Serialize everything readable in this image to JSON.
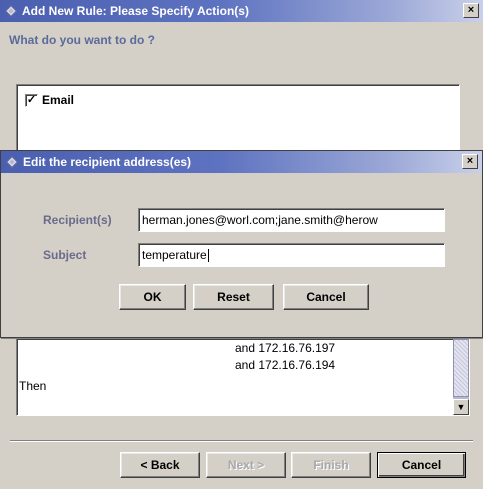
{
  "back_window": {
    "title": "Add New Rule: Please Specify Action(s)",
    "close": "×",
    "question": "What do you want to do ?",
    "actions": [
      {
        "label": "Email",
        "checked": true,
        "mark": "✓"
      }
    ],
    "rule_text": {
      "line1": "and 172.16.76.197",
      "line2": "and 172.16.76.194",
      "line3": "Then"
    },
    "buttons": {
      "back": "< Back",
      "next": "Next >",
      "finish": "Finish",
      "cancel": "Cancel"
    }
  },
  "dialog": {
    "title": "Edit the recipient address(es)",
    "close": "×",
    "recipients_label": "Recipient(s)",
    "recipients_value": "herman.jones@worl.com;jane.smith@herow",
    "subject_label": "Subject",
    "subject_value": "temperature",
    "buttons": {
      "ok": "OK",
      "reset": "Reset",
      "cancel": "Cancel"
    }
  },
  "colors": {
    "title_gradient_start": "#4b5fb0",
    "title_gradient_end": "#c9d0ea",
    "label_color": "#6a6a8a",
    "window_bg": "#d4d0c8"
  }
}
